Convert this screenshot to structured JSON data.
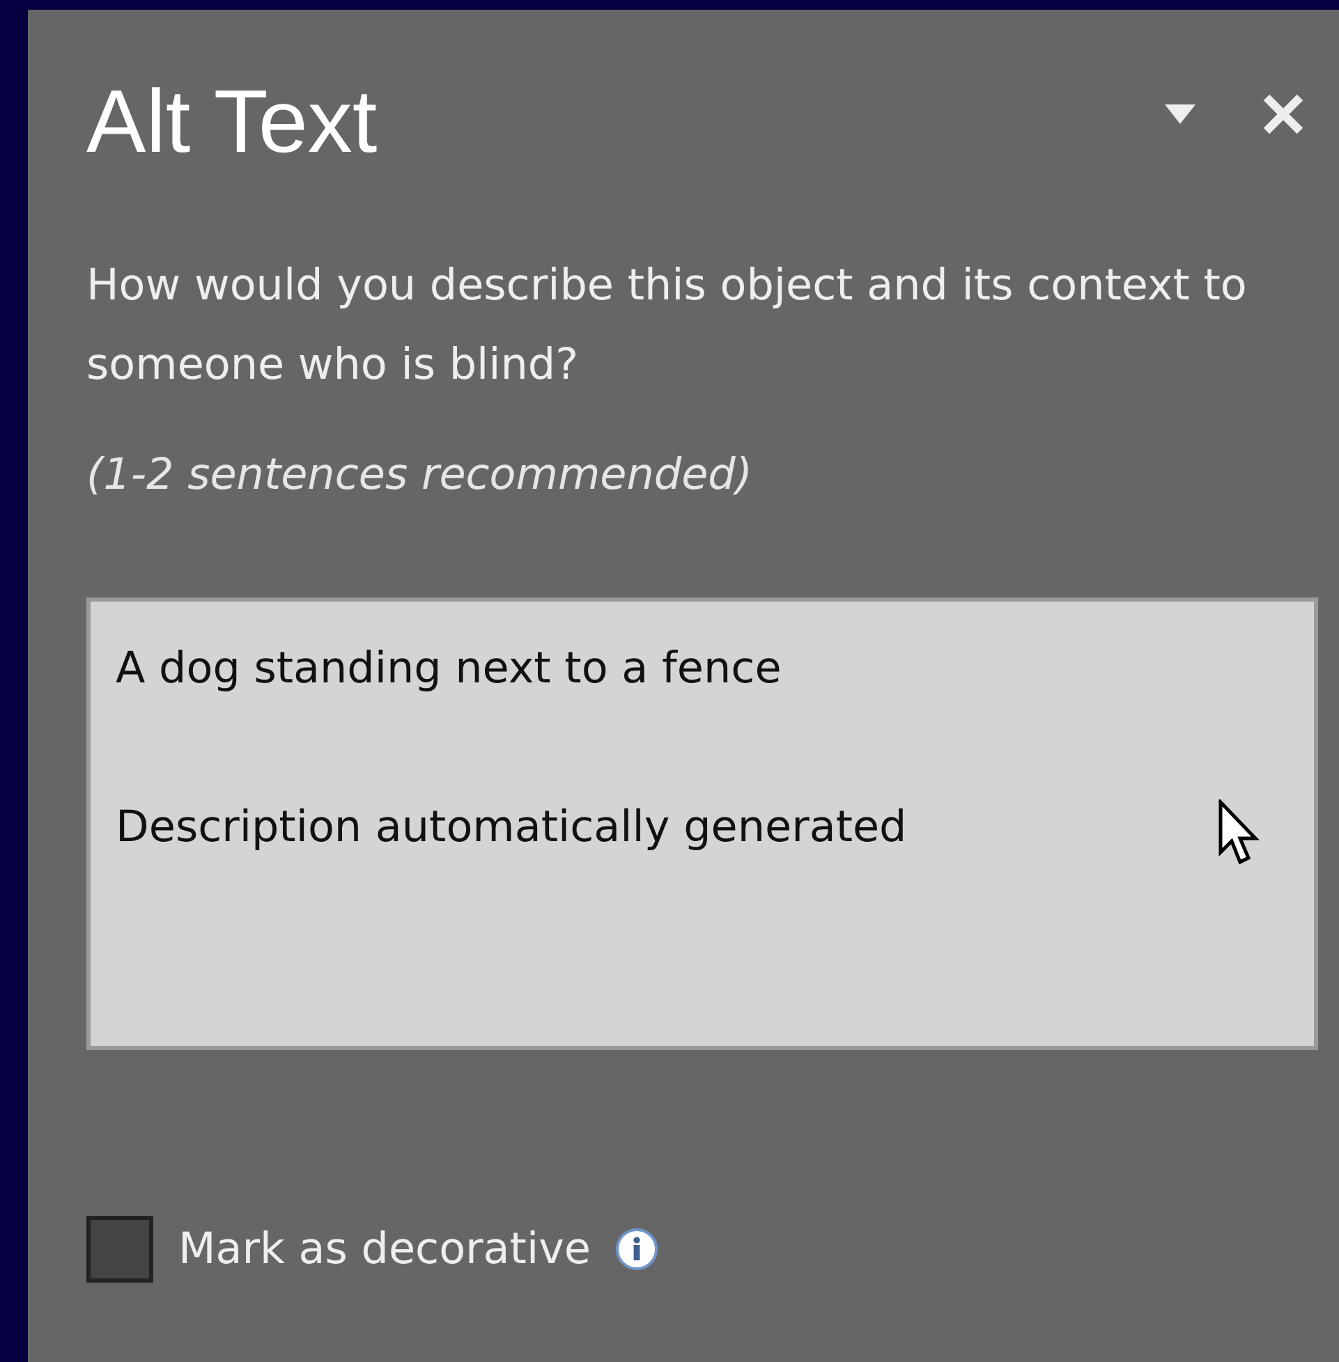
{
  "pane": {
    "title": "Alt Text",
    "question": "How would you describe this object and its context to someone who is blind?",
    "hint": "(1-2 sentences recommended)",
    "description": {
      "value": "A dog standing next to a fence\n\nDescription automatically generated"
    },
    "decorative": {
      "label": "Mark as decorative",
      "checked": false
    }
  }
}
